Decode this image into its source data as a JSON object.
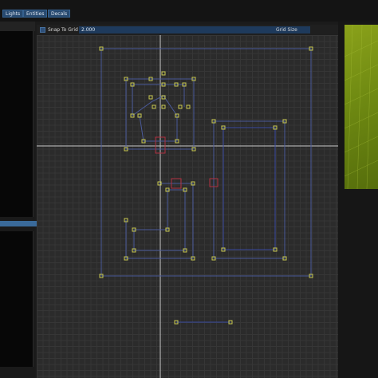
{
  "toolbar": {
    "buttons": [
      {
        "label": "Lights"
      },
      {
        "label": "Entities"
      },
      {
        "label": "Decals"
      }
    ]
  },
  "viewport_toolbar": {
    "snap_label": "Snap To Grid",
    "snap_value": "2.000",
    "grid_size_label": "Grid Size"
  },
  "colors": {
    "grid_background": "#2b2b2b",
    "grid_lines": "#363636",
    "axis": "#c8c8c8",
    "wall": "#4a5a9a",
    "vertex": "#c8c850",
    "entity": "#b03040",
    "accent": "#27496f",
    "preview": "#7a9a10"
  }
}
